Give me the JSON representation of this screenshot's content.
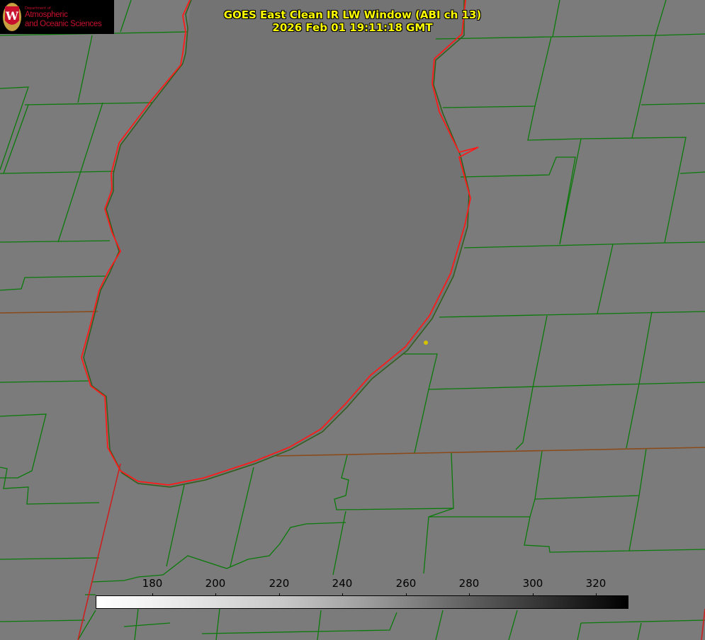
{
  "title": {
    "line1": "GOES East Clean IR LW Window (ABI ch 13)",
    "line2": "2026 Feb 01 19:11:18 GMT"
  },
  "logo": {
    "dept": "Department of",
    "line1": "Atmospheric",
    "line2": "and Oceanic Sciences",
    "emblem": "W"
  },
  "colorbar": {
    "ticks": [
      "180",
      "200",
      "220",
      "240",
      "260",
      "280",
      "300",
      "320"
    ],
    "range": [
      162,
      330
    ],
    "colormap": "white-to-black"
  },
  "colors": {
    "background": "#7b7b7b",
    "lake": "#737373",
    "county_lines": "#0a7a0a",
    "coastline": "#ff1a1a",
    "title": "#ffff00",
    "marker": "#d4c400"
  }
}
